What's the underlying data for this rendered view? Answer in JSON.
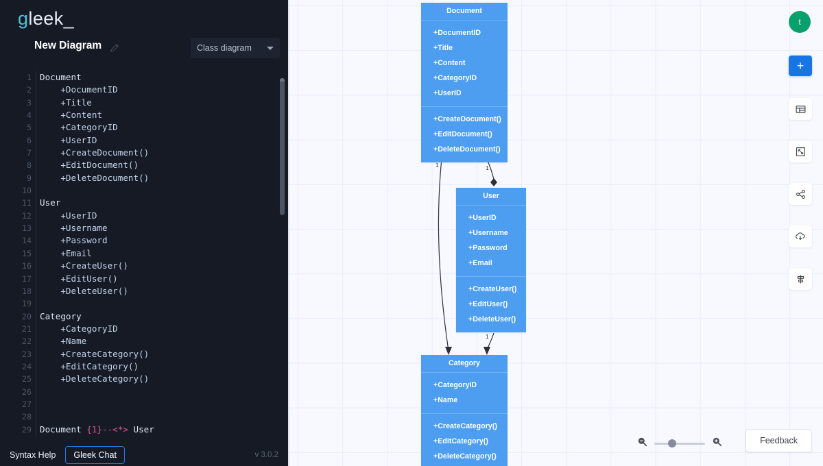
{
  "brand": {
    "prefix": "g",
    "mid": "leek",
    "suffix": "_"
  },
  "header": {
    "diagram_title": "New Diagram",
    "edit_icon": "pencil-icon",
    "diagram_type": "Class diagram",
    "caret_icon": "chevron-down-icon"
  },
  "editor": {
    "lines": [
      {
        "n": "1",
        "indent": "",
        "text": "Document",
        "kind": "cls"
      },
      {
        "n": "2",
        "indent": "    ",
        "text": "+DocumentID",
        "kind": "mem"
      },
      {
        "n": "3",
        "indent": "    ",
        "text": "+Title",
        "kind": "mem"
      },
      {
        "n": "4",
        "indent": "    ",
        "text": "+Content",
        "kind": "mem"
      },
      {
        "n": "5",
        "indent": "    ",
        "text": "+CategoryID",
        "kind": "mem"
      },
      {
        "n": "6",
        "indent": "    ",
        "text": "+UserID",
        "kind": "mem"
      },
      {
        "n": "7",
        "indent": "    ",
        "text": "+CreateDocument()",
        "kind": "mem"
      },
      {
        "n": "8",
        "indent": "    ",
        "text": "+EditDocument()",
        "kind": "mem"
      },
      {
        "n": "9",
        "indent": "    ",
        "text": "+DeleteDocument()",
        "kind": "mem"
      },
      {
        "n": "10",
        "indent": "",
        "text": "",
        "kind": "mem"
      },
      {
        "n": "11",
        "indent": "",
        "text": "User",
        "kind": "cls"
      },
      {
        "n": "12",
        "indent": "    ",
        "text": "+UserID",
        "kind": "mem"
      },
      {
        "n": "13",
        "indent": "    ",
        "text": "+Username",
        "kind": "mem"
      },
      {
        "n": "14",
        "indent": "    ",
        "text": "+Password",
        "kind": "mem"
      },
      {
        "n": "15",
        "indent": "    ",
        "text": "+Email",
        "kind": "mem"
      },
      {
        "n": "16",
        "indent": "    ",
        "text": "+CreateUser()",
        "kind": "mem"
      },
      {
        "n": "17",
        "indent": "    ",
        "text": "+EditUser()",
        "kind": "mem"
      },
      {
        "n": "18",
        "indent": "    ",
        "text": "+DeleteUser()",
        "kind": "mem"
      },
      {
        "n": "19",
        "indent": "",
        "text": "",
        "kind": "mem"
      },
      {
        "n": "20",
        "indent": "",
        "text": "Category",
        "kind": "cls"
      },
      {
        "n": "21",
        "indent": "    ",
        "text": "+CategoryID",
        "kind": "mem"
      },
      {
        "n": "22",
        "indent": "    ",
        "text": "+Name",
        "kind": "mem"
      },
      {
        "n": "23",
        "indent": "    ",
        "text": "+CreateCategory()",
        "kind": "mem"
      },
      {
        "n": "24",
        "indent": "    ",
        "text": "+EditCategory()",
        "kind": "mem"
      },
      {
        "n": "25",
        "indent": "    ",
        "text": "+DeleteCategory()",
        "kind": "mem"
      },
      {
        "n": "26",
        "indent": "",
        "text": "",
        "kind": "mem"
      },
      {
        "n": "27",
        "indent": "",
        "text": "",
        "kind": "mem"
      },
      {
        "n": "28",
        "indent": "",
        "text": "",
        "kind": "mem"
      },
      {
        "n": "29",
        "indent": "",
        "text": "Document ",
        "kind": "cls",
        "rel": "{1}--<*>",
        "tail": " User"
      }
    ]
  },
  "footer": {
    "syntax_help": "Syntax Help",
    "gleek_chat": "Gleek Chat",
    "version": "v 3.0.2"
  },
  "diagram": {
    "nodes": [
      {
        "name": "Document",
        "attributes": [
          "+DocumentID",
          "+Title",
          "+Content",
          "+CategoryID",
          "+UserID"
        ],
        "methods": [
          "+CreateDocument()",
          "+EditDocument()",
          "+DeleteDocument()"
        ]
      },
      {
        "name": "User",
        "attributes": [
          "+UserID",
          "+Username",
          "+Password",
          "+Email"
        ],
        "methods": [
          "+CreateUser()",
          "+EditUser()",
          "+DeleteUser()"
        ]
      },
      {
        "name": "Category",
        "attributes": [
          "+CategoryID",
          "+Name"
        ],
        "methods": [
          "+CreateCategory()",
          "+EditCategory()",
          "+DeleteCategory()"
        ]
      }
    ],
    "multiplicities": [
      "1",
      "1",
      "1"
    ],
    "node_color": "#4d9ef0"
  },
  "toolbar": {
    "avatar_initial": "t",
    "add_label": "+",
    "items": [
      {
        "icon": "table-icon"
      },
      {
        "icon": "fit-screen-icon"
      },
      {
        "icon": "share-icon"
      },
      {
        "icon": "cloud-download-icon"
      },
      {
        "icon": "align-center-icon"
      }
    ]
  },
  "zoom": {
    "out_icon": "zoom-out-icon",
    "in_icon": "zoom-in-icon"
  },
  "feedback": {
    "label": "Feedback"
  }
}
